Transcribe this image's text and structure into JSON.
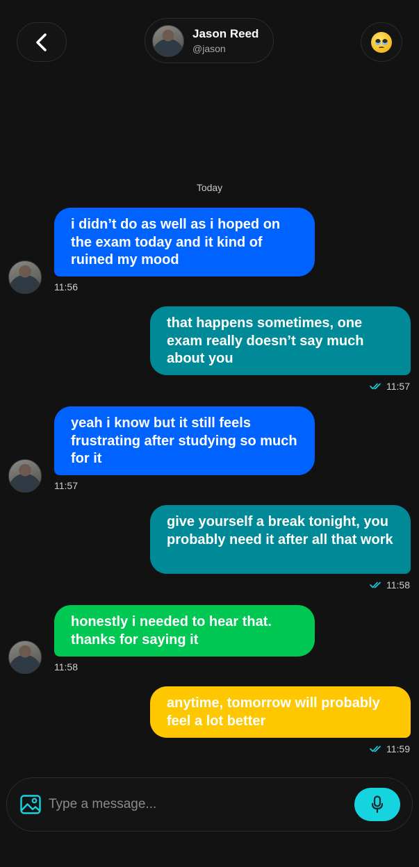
{
  "header": {
    "contact_name": "Jason Reed",
    "contact_handle": "@jason",
    "back_icon": "chevron-left-icon",
    "mood_icon": "pleading-face-emoji"
  },
  "day_label": "Today",
  "colors": {
    "background": "#121212",
    "incoming_blue": "#0062ff",
    "outgoing_teal": "#008996",
    "incoming_green": "#00c853",
    "outgoing_yellow": "#ffc700",
    "accent_cyan": "#16d3e0"
  },
  "messages": [
    {
      "direction": "incoming",
      "text": "i didn’t do as well as i hoped on the exam today and it kind of ruined my mood",
      "time": "11:56",
      "color": "#0062ff"
    },
    {
      "direction": "outgoing",
      "text": "that happens sometimes, one exam really doesn’t say much about you",
      "time": "11:57",
      "color": "#008996"
    },
    {
      "direction": "incoming",
      "text": "yeah i know but it still feels frustrating after studying so much for it",
      "time": "11:57",
      "color": "#0062ff"
    },
    {
      "direction": "outgoing",
      "text": "give yourself a break tonight, you probably need it after all that work",
      "time": "11:58",
      "color": "#008996"
    },
    {
      "direction": "incoming",
      "text": "honestly i needed to hear that. thanks for saying it",
      "time": "11:58",
      "color": "#00c853"
    },
    {
      "direction": "outgoing",
      "text": "anytime, tomorrow will probably feel a lot better",
      "time": "11:59",
      "color": "#ffc700"
    }
  ],
  "composer": {
    "placeholder": "Type a message...",
    "image_icon": "image-icon",
    "mic_icon": "microphone-icon"
  }
}
